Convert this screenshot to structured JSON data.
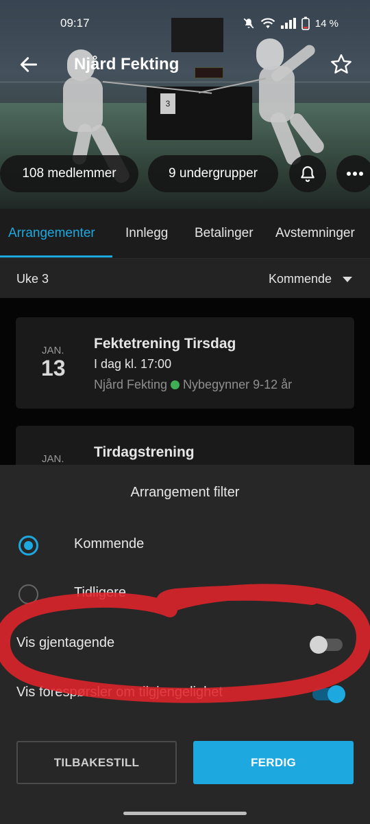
{
  "status_bar": {
    "time": "09:17",
    "battery": "14 %"
  },
  "header": {
    "title": "Njård Fekting"
  },
  "hero_photo": {
    "placard": "3"
  },
  "chips": {
    "members": "108 medlemmer",
    "subgroups": "9 undergrupper"
  },
  "tabs": [
    {
      "label": "Arrangementer",
      "active": true
    },
    {
      "label": "Innlegg",
      "active": false
    },
    {
      "label": "Betalinger",
      "active": false
    },
    {
      "label": "Avstemninger",
      "active": false
    }
  ],
  "filter_bar": {
    "week": "Uke 3",
    "sort": "Kommende"
  },
  "events": [
    {
      "month": "JAN.",
      "day": "13",
      "title": "Fektetrening Tirsdag",
      "time": "I dag kl. 17:00",
      "group": "Njård Fekting",
      "subgroup": "Nybegynner 9-12 år"
    },
    {
      "month": "JAN.",
      "title": "Tirdagstrening"
    }
  ],
  "sheet": {
    "title": "Arrangement filter",
    "options": [
      {
        "label": "Kommende",
        "checked": true
      },
      {
        "label": "Tidligere",
        "checked": false
      }
    ],
    "toggles": [
      {
        "label": "Vis gjentagende",
        "on": false
      },
      {
        "label": "Vis forespørsler om tilgjengelighet",
        "on": true
      }
    ],
    "reset_label": "TILBAKESTILL",
    "done_label": "FERDIG"
  },
  "colors": {
    "accent": "#1ea8e0",
    "sheet_bg": "#272727",
    "annotation": "#e0242b",
    "status_green": "#3fae55"
  },
  "icons": [
    "back-arrow-icon",
    "star-outline-icon",
    "bell-icon",
    "more-horizontal-icon",
    "mute-icon",
    "wifi-icon",
    "signal-icon",
    "battery-icon",
    "dropdown-caret-icon"
  ]
}
